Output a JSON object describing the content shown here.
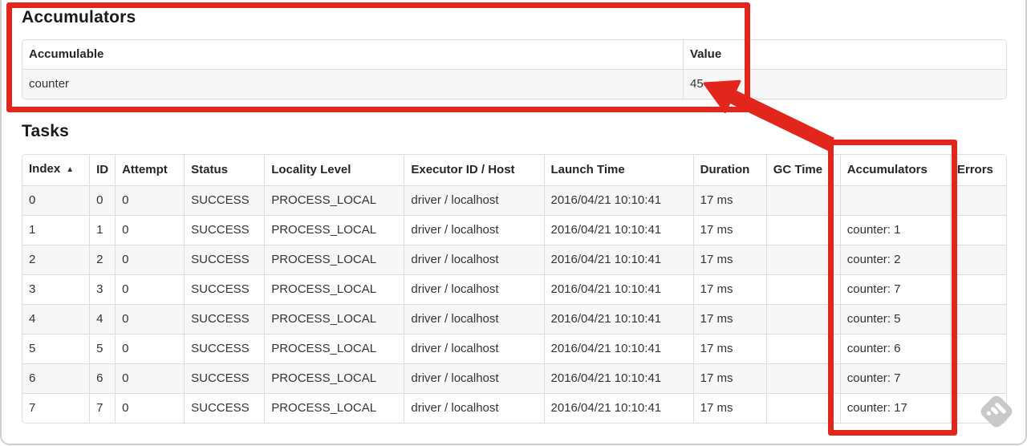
{
  "annotations": {
    "color": "#e2261c"
  },
  "accumulators_section": {
    "title": "Accumulators",
    "table": {
      "columns": [
        {
          "label": "Accumulable"
        },
        {
          "label": "Value"
        }
      ],
      "rows": [
        [
          "counter",
          "45"
        ]
      ]
    }
  },
  "tasks_section": {
    "title": "Tasks",
    "table": {
      "columns": [
        {
          "label": "Index",
          "sort_indicator": "▲"
        },
        {
          "label": "ID"
        },
        {
          "label": "Attempt"
        },
        {
          "label": "Status"
        },
        {
          "label": "Locality Level"
        },
        {
          "label": "Executor ID / Host"
        },
        {
          "label": "Launch Time"
        },
        {
          "label": "Duration"
        },
        {
          "label": "GC Time"
        },
        {
          "label": "Accumulators"
        },
        {
          "label": "Errors"
        }
      ],
      "rows": [
        [
          "0",
          "0",
          "0",
          "SUCCESS",
          "PROCESS_LOCAL",
          "driver / localhost",
          "2016/04/21 10:10:41",
          "17 ms",
          "",
          "",
          ""
        ],
        [
          "1",
          "1",
          "0",
          "SUCCESS",
          "PROCESS_LOCAL",
          "driver / localhost",
          "2016/04/21 10:10:41",
          "17 ms",
          "",
          "counter: 1",
          ""
        ],
        [
          "2",
          "2",
          "0",
          "SUCCESS",
          "PROCESS_LOCAL",
          "driver / localhost",
          "2016/04/21 10:10:41",
          "17 ms",
          "",
          "counter: 2",
          ""
        ],
        [
          "3",
          "3",
          "0",
          "SUCCESS",
          "PROCESS_LOCAL",
          "driver / localhost",
          "2016/04/21 10:10:41",
          "17 ms",
          "",
          "counter: 7",
          ""
        ],
        [
          "4",
          "4",
          "0",
          "SUCCESS",
          "PROCESS_LOCAL",
          "driver / localhost",
          "2016/04/21 10:10:41",
          "17 ms",
          "",
          "counter: 5",
          ""
        ],
        [
          "5",
          "5",
          "0",
          "SUCCESS",
          "PROCESS_LOCAL",
          "driver / localhost",
          "2016/04/21 10:10:41",
          "17 ms",
          "",
          "counter: 6",
          ""
        ],
        [
          "6",
          "6",
          "0",
          "SUCCESS",
          "PROCESS_LOCAL",
          "driver / localhost",
          "2016/04/21 10:10:41",
          "17 ms",
          "",
          "counter: 7",
          ""
        ],
        [
          "7",
          "7",
          "0",
          "SUCCESS",
          "PROCESS_LOCAL",
          "driver / localhost",
          "2016/04/21 10:10:41",
          "17 ms",
          "",
          "counter: 17",
          ""
        ]
      ]
    }
  },
  "watermark": {
    "icon": "skitch-watermark-icon",
    "color": "#c9c9c9"
  }
}
